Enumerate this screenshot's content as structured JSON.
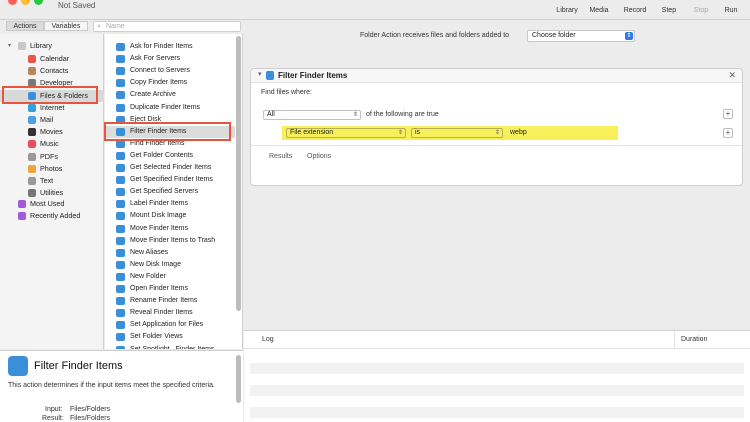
{
  "window": {
    "doc_title": "Not Saved",
    "traffic_colors": [
      "#fd5f57",
      "#febc2e",
      "#28c840"
    ]
  },
  "toolbar": {
    "buttons": [
      {
        "label": "Library",
        "icon": "library-icon"
      },
      {
        "label": "Media",
        "icon": "media-icon"
      },
      {
        "label": "Record",
        "icon": "record-icon"
      },
      {
        "label": "Step",
        "icon": "step-icon"
      },
      {
        "label": "Stop",
        "icon": "stop-icon"
      },
      {
        "label": "Run",
        "icon": "run-icon"
      }
    ]
  },
  "left_tabs": {
    "actions": "Actions",
    "variables": "Variables",
    "search_placeholder": "Name"
  },
  "library": {
    "root": "Library",
    "items": [
      {
        "label": "Calendar",
        "icon": "calendar-icon",
        "color": "#e8574a"
      },
      {
        "label": "Contacts",
        "icon": "contacts-icon",
        "color": "#b8865a"
      },
      {
        "label": "Developer",
        "icon": "developer-icon",
        "color": "#7a7a7a"
      },
      {
        "label": "Files & Folders",
        "icon": "finder-icon",
        "color": "#3b8ed8"
      },
      {
        "label": "Internet",
        "icon": "internet-icon",
        "color": "#3a9fd6"
      },
      {
        "label": "Mail",
        "icon": "mail-icon",
        "color": "#4aa3e8"
      },
      {
        "label": "Movies",
        "icon": "movies-icon",
        "color": "#333333"
      },
      {
        "label": "Music",
        "icon": "music-icon",
        "color": "#f04b5f"
      },
      {
        "label": "PDFs",
        "icon": "pdf-icon",
        "color": "#9a9a9a"
      },
      {
        "label": "Photos",
        "icon": "photos-icon",
        "color": "#f2a33a"
      },
      {
        "label": "Text",
        "icon": "text-icon",
        "color": "#9a9a9a"
      },
      {
        "label": "Utilities",
        "icon": "utilities-icon",
        "color": "#777777"
      }
    ],
    "extras": [
      {
        "label": "Most Used",
        "icon": "most-used-icon",
        "color": "#a35ad6"
      },
      {
        "label": "Recently Added",
        "icon": "recently-added-icon",
        "color": "#a35ad6"
      }
    ]
  },
  "actions": {
    "items": [
      "Ask for Finder Items",
      "Ask For Servers",
      "Connect to Servers",
      "Copy Finder Items",
      "Create Archive",
      "Duplicate Finder Items",
      "Eject Disk",
      "Filter Finder Items",
      "Find Finder Items",
      "Get Folder Contents",
      "Get Selected Finder Items",
      "Get Specified Finder Items",
      "Get Specified Servers",
      "Label Finder Items",
      "Mount Disk Image",
      "Move Finder Items",
      "Move Finder Items to Trash",
      "New Aliases",
      "New Disk Image",
      "New Folder",
      "Open Finder Items",
      "Rename Finder Items",
      "Reveal Finder Items",
      "Set Application for Files",
      "Set Folder Views",
      "Set Spotlight...Finder Items"
    ]
  },
  "description": {
    "title": "Filter Finder Items",
    "text": "This action determines if the input items meet the specified criteria.",
    "input_label": "Input:",
    "input_value": "Files/Folders",
    "result_label": "Result:",
    "result_value": "Files/Folders"
  },
  "workflow": {
    "folder_action_label": "Folder Action receives files and folders added to",
    "folder_select": "Choose folder",
    "card": {
      "title": "Filter Finder Items",
      "find_label": "Find files where:",
      "match_select": "All",
      "of_following": "of the following are true",
      "criteria": {
        "attribute": "File extension",
        "operator": "is",
        "value": "webp"
      },
      "tabs": [
        "Results",
        "Options"
      ]
    }
  },
  "log": {
    "col_log": "Log",
    "col_duration": "Duration"
  },
  "colors": {
    "highlight": "#e4573d",
    "criteria_highlight": "#f7f05a",
    "accent": "#2f7ae5"
  }
}
